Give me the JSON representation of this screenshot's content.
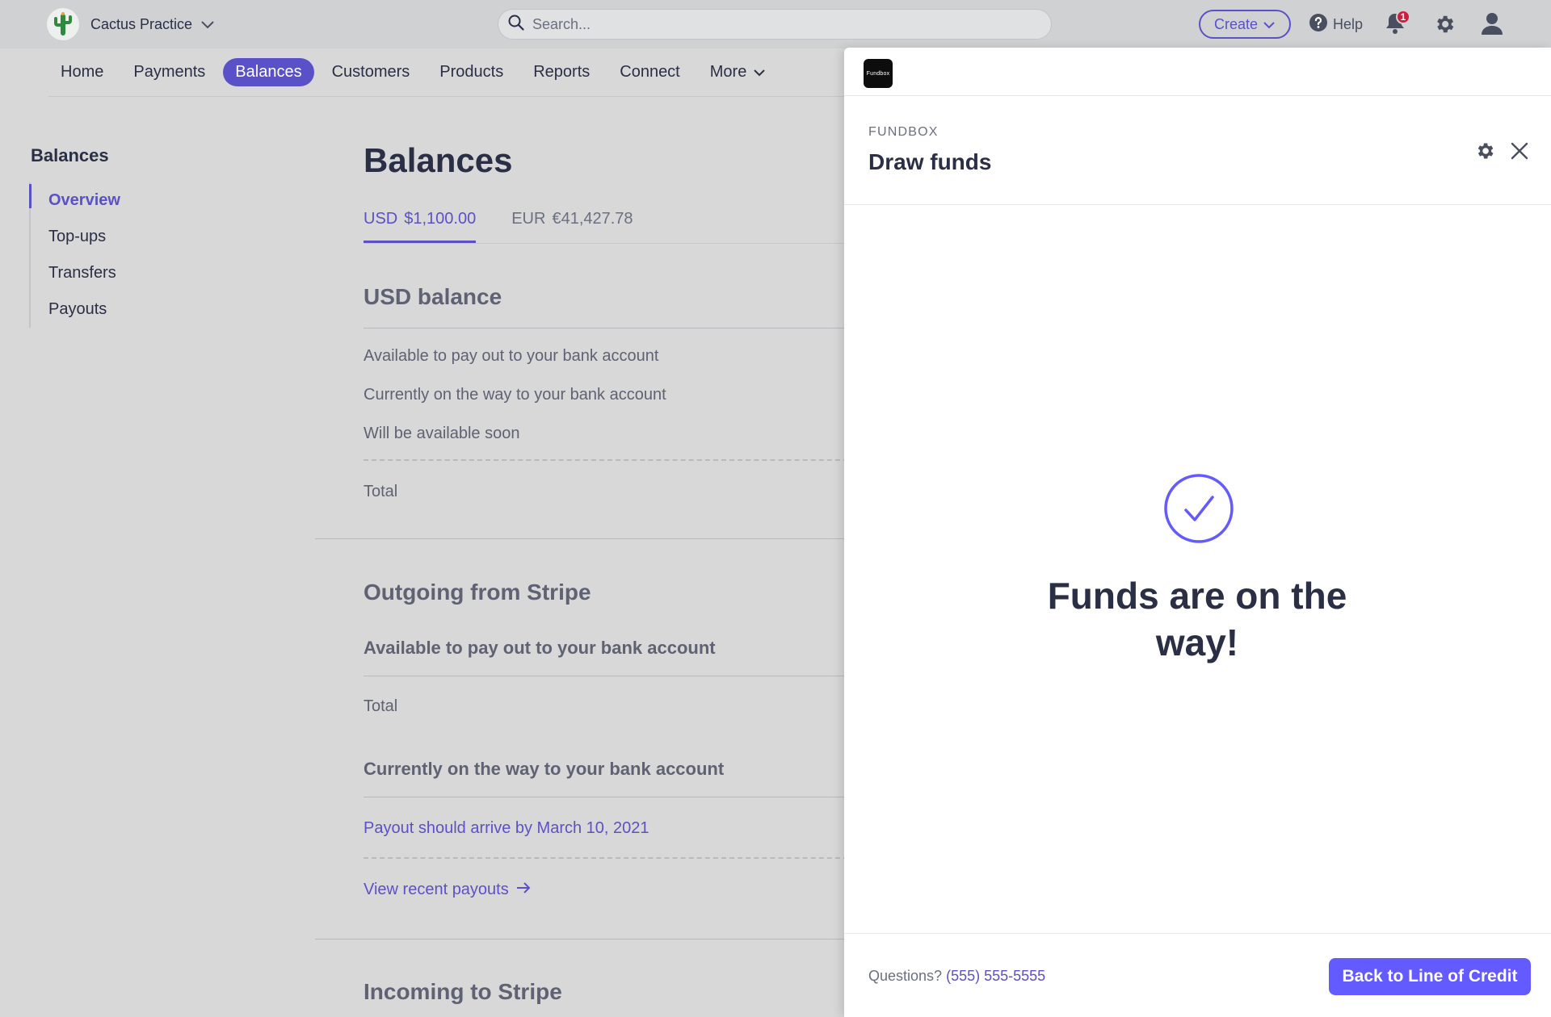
{
  "topbar": {
    "account_name": "Cactus Practice",
    "search_placeholder": "Search...",
    "create_label": "Create",
    "help_label": "Help",
    "notification_count": "1"
  },
  "nav": {
    "items": [
      {
        "label": "Home"
      },
      {
        "label": "Payments"
      },
      {
        "label": "Balances",
        "active": true
      },
      {
        "label": "Customers"
      },
      {
        "label": "Products"
      },
      {
        "label": "Reports"
      },
      {
        "label": "Connect"
      },
      {
        "label": "More"
      }
    ]
  },
  "sidebar": {
    "title": "Balances",
    "items": [
      {
        "label": "Overview",
        "active": true
      },
      {
        "label": "Top-ups"
      },
      {
        "label": "Transfers"
      },
      {
        "label": "Payouts"
      }
    ]
  },
  "main": {
    "title": "Balances",
    "tabs": [
      {
        "currency": "USD",
        "amount": "$1,100.00",
        "active": true
      },
      {
        "currency": "EUR",
        "amount": "€41,427.78"
      }
    ],
    "usd_balance": {
      "title": "USD balance",
      "rows": [
        "Available to pay out to your bank account",
        "Currently on the way to your bank account",
        "Will be available soon"
      ],
      "total_label": "Total"
    },
    "outgoing": {
      "title": "Outgoing from Stripe",
      "available_title": "Available to pay out to your bank account",
      "total_label": "Total",
      "on_way_title": "Currently on the way to your bank account",
      "arrival_link": "Payout should arrive by March 10, 2021",
      "recent_link": "View recent payouts"
    },
    "incoming": {
      "title": "Incoming to Stripe"
    }
  },
  "drawer": {
    "app_logo_text": "Fundbox",
    "eyebrow": "FUNDBOX",
    "title": "Draw funds",
    "success_message": "Funds are on the way!",
    "questions_label": "Questions?",
    "phone": "(555) 555-5555",
    "back_button": "Back to Line of Credit"
  },
  "colors": {
    "accent": "#5a51c9",
    "button": "#635bff",
    "notification": "#cd1f3c",
    "cactus": "#2e8b3c"
  },
  "icons": [
    "cactus-logo-icon",
    "chevron-down-icon",
    "search-icon",
    "help-icon",
    "bell-icon",
    "gear-icon",
    "user-icon",
    "close-icon",
    "check-circle-icon",
    "arrow-right-icon"
  ]
}
